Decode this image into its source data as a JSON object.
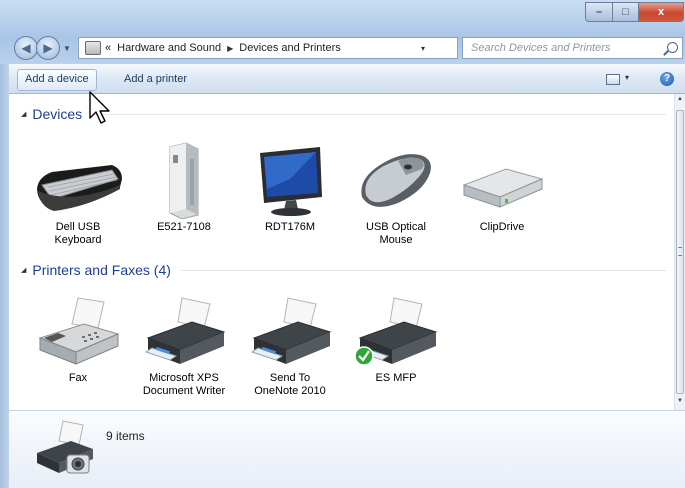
{
  "titlebar": {
    "minimize": "–",
    "maximize": "□",
    "close": "x"
  },
  "nav": {
    "back": "◀",
    "forward": "▶",
    "history": "▼"
  },
  "address": {
    "chevron": "«",
    "crumbs": [
      "Hardware and Sound",
      "Devices and Printers"
    ],
    "sep": "▶",
    "dropdown": "▾",
    "refresh": "↻"
  },
  "search": {
    "placeholder": "Search Devices and Printers"
  },
  "toolbar": {
    "add_device": "Add a device",
    "add_printer": "Add a printer",
    "help": "?",
    "view_dropdown": "▾"
  },
  "groups": {
    "devices": {
      "title": "Devices",
      "toggle": "◢"
    },
    "printers": {
      "title": "Printers and Faxes (4)",
      "toggle": "◢"
    }
  },
  "devices": [
    {
      "icon": "keyboard-icon",
      "line1": "Dell USB",
      "line2": "Keyboard"
    },
    {
      "icon": "tower-pc-icon",
      "line1": "E521-7108",
      "line2": ""
    },
    {
      "icon": "monitor-icon",
      "line1": "RDT176M",
      "line2": ""
    },
    {
      "icon": "mouse-icon",
      "line1": "USB Optical",
      "line2": "Mouse"
    },
    {
      "icon": "drive-icon",
      "line1": "ClipDrive",
      "line2": ""
    }
  ],
  "printers": [
    {
      "icon": "fax-icon",
      "line1": "Fax",
      "line2": ""
    },
    {
      "icon": "printer-icon",
      "line1": "Microsoft XPS",
      "line2": "Document Writer"
    },
    {
      "icon": "printer-icon",
      "line1": "Send To",
      "line2": "OneNote 2010"
    },
    {
      "icon": "default-printer-icon",
      "line1": "ES      MFP",
      "line2": "",
      "default": true
    }
  ],
  "details": {
    "count": "9 items"
  },
  "colors": {
    "group_heading": "#1e3f93",
    "accent": "#2b64c6",
    "close_button": "#c9462c"
  }
}
